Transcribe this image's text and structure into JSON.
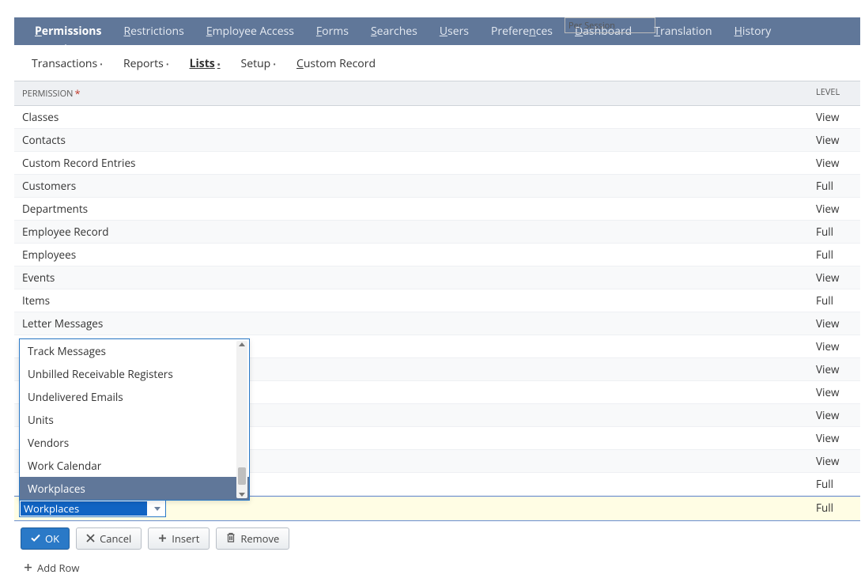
{
  "legacy_select": "Per Session",
  "tabs": [
    {
      "html": "<span class='u'>P</span>ermissions",
      "active": true
    },
    {
      "html": "<span class='u'>R</span>estrictions"
    },
    {
      "html": "<span class='u'>E</span>mployee Access"
    },
    {
      "html": "<span class='u'>F</span>orms"
    },
    {
      "html": "<span class='u'>S</span>earches"
    },
    {
      "html": "<span class='u'>U</span>sers"
    },
    {
      "html": "Prefere<span class='u'>n</span>ces"
    },
    {
      "html": "<span class='u'>D</span>ashboard"
    },
    {
      "html": "<span class='u'>T</span>ranslation"
    },
    {
      "html": "<span class='u'>H</span>istory"
    }
  ],
  "subtabs": [
    {
      "label": "Transactions",
      "has_menu": true
    },
    {
      "label": "Reports",
      "has_menu": true
    },
    {
      "html": "<span class='u'>L</span>ists",
      "has_menu": true,
      "active": true
    },
    {
      "label": "Setup",
      "has_menu": true
    },
    {
      "html": "<span class='u'>C</span>ustom Record"
    }
  ],
  "columns": {
    "permission": "PERMISSION",
    "level": "LEVEL"
  },
  "rows": [
    {
      "permission": "Classes",
      "level": "View"
    },
    {
      "permission": "Contacts",
      "level": "View"
    },
    {
      "permission": "Custom Record Entries",
      "level": "View"
    },
    {
      "permission": "Customers",
      "level": "Full"
    },
    {
      "permission": "Departments",
      "level": "View"
    },
    {
      "permission": "Employee Record",
      "level": "Full"
    },
    {
      "permission": "Employees",
      "level": "Full"
    },
    {
      "permission": "Events",
      "level": "View"
    },
    {
      "permission": "Items",
      "level": "Full"
    },
    {
      "permission": "Letter Messages",
      "level": "View"
    },
    {
      "permission": "",
      "level": "View"
    },
    {
      "permission": "",
      "level": "View"
    },
    {
      "permission": "",
      "level": "View"
    },
    {
      "permission": "",
      "level": "View"
    },
    {
      "permission": "",
      "level": "View"
    },
    {
      "permission": "",
      "level": "View"
    },
    {
      "permission": "",
      "level": "Full"
    }
  ],
  "editing": {
    "value": "Workplaces",
    "level": "Full",
    "options": [
      "Track Messages",
      "Unbilled Receivable Registers",
      "Undelivered Emails",
      "Units",
      "Vendors",
      "Work Calendar",
      "Workplaces"
    ],
    "selected_index": 6
  },
  "buttons": {
    "ok": "OK",
    "cancel": "Cancel",
    "insert": "Insert",
    "remove": "Remove"
  },
  "addrow": "Add Row"
}
